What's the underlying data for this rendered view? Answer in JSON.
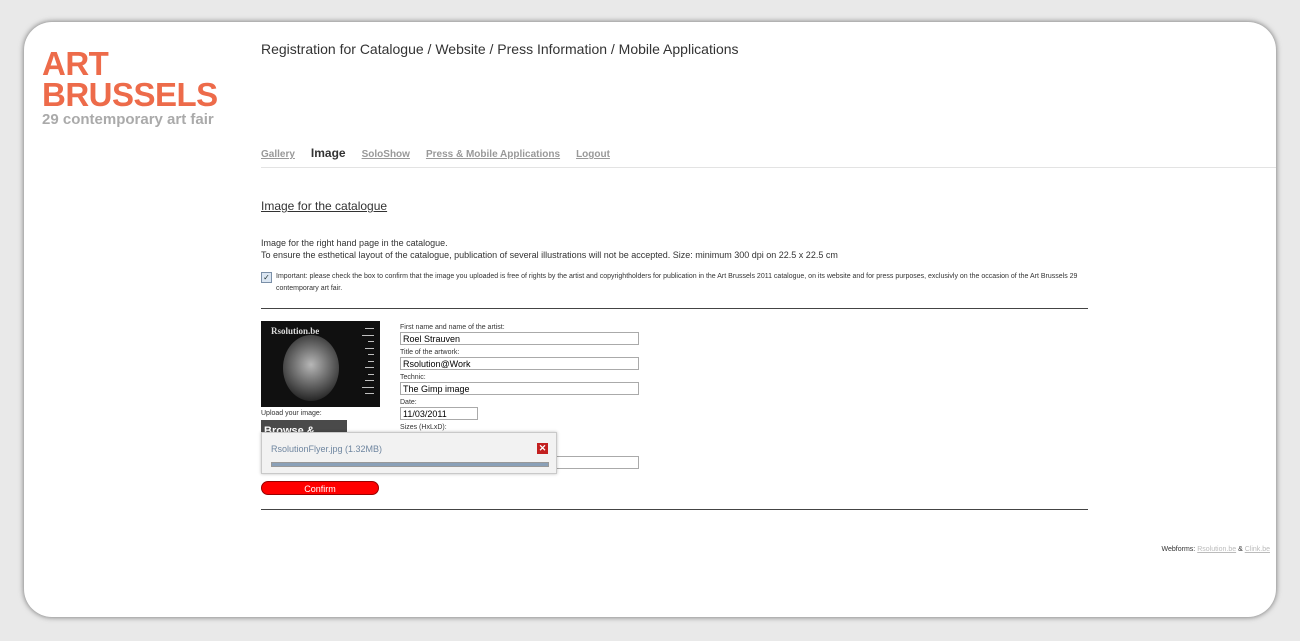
{
  "logo": {
    "line1": "ART",
    "line2": "BRUSSELS",
    "line3": "29 contemporary art fair"
  },
  "page_title": "Registration for Catalogue / Website / Press Information / Mobile Applications",
  "nav": {
    "gallery": "Gallery",
    "image": "Image",
    "soloshow": "SoloShow",
    "press": "Press & Mobile Applications",
    "logout": "Logout"
  },
  "section": {
    "heading": "Image for the catalogue",
    "desc_line1": "Image for the right hand page in the catalogue.",
    "desc_line2": "To ensure the esthetical layout of the catalogue, publication of several illustrations will not be accepted. Size: minimum 300 dpi on 22.5 x 22.5 cm",
    "rights_checked": true,
    "rights_text": "Important: please check the box to confirm that the image you uploaded is free of rights by the artist and copyrightholders for publication in the Art Brussels 2011 catalogue, on its website and for press purposes, exclusivly on the occasion of the Art Brussels 29 contemporary art fair."
  },
  "thumbnail": {
    "title": "Rsolution.be"
  },
  "upload": {
    "label": "Upload your image:",
    "browse_label": "Browse & Upload",
    "file_name": "RsolutionFlyer.jpg (1.32MB)",
    "progress": 1.0
  },
  "form": {
    "artist_label": "First name and name of the artist:",
    "artist_value": "Roel Strauven",
    "title_label": "Title of the artwork:",
    "title_value": "Rsolution@Work",
    "technic_label": "Technic:",
    "technic_value": "The Gimp image",
    "date_label": "Date:",
    "date_value": "11/03/2011",
    "sizes_label": "Sizes (HxLxD):",
    "sizes_value": "",
    "extra_value": ""
  },
  "confirm_label": "Confirm",
  "footer": {
    "prefix": "Webforms:",
    "link1": "Rsolution.be",
    "amp": "&",
    "link2": "Clink.be"
  },
  "colors": {
    "brand": "#ed6b4a",
    "confirm": "#ff0000",
    "close": "#c32020"
  }
}
